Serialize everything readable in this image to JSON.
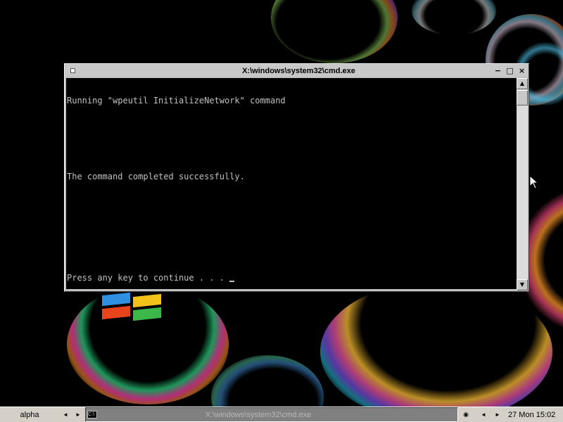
{
  "window": {
    "title": "X:\\windows\\system32\\cmd.exe",
    "minimize_glyph": "−",
    "maximize_glyph": "□",
    "close_glyph": "×"
  },
  "console": {
    "lines": [
      "Running \"wpeutil InitializeNetwork\" command",
      "",
      "",
      "The command completed successfully.",
      "",
      "",
      "",
      "Press any key to continue . . . "
    ],
    "text_color": "#c0c0c0",
    "background": "#000000"
  },
  "scrollbar": {
    "up_glyph": "▲",
    "down_glyph": "▼"
  },
  "taskbar": {
    "start_label": "alpha",
    "left_arrow": "◄",
    "right_arrow": "►",
    "task_label": "X:\\windows\\system32\\cmd.exe",
    "task_icon_text": "C:\\",
    "indicator_glyph": "◉",
    "tray_left_arrow": "◄",
    "tray_right_arrow": "►",
    "clock": "27 Mon 15:02"
  },
  "colors": {
    "taskbar": "#d4d0c8",
    "window_frame": "#c0c0c0",
    "active_task": "#808080"
  }
}
